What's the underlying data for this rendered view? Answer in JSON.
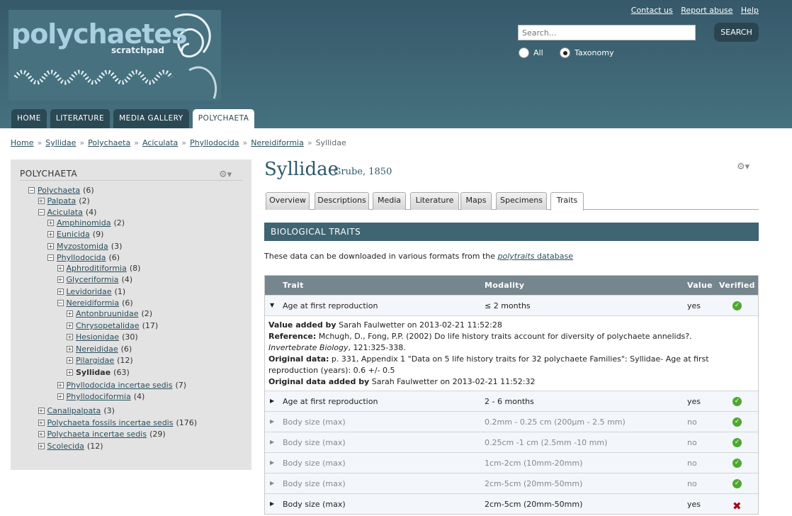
{
  "header": {
    "logo_text": "polychaetes",
    "logo_subtext": "scratchpad",
    "top_links": [
      "Contact us",
      "Report abuse",
      "Help"
    ],
    "search_placeholder": "Search...",
    "search_button": "SEARCH",
    "radio_all": "All",
    "radio_taxonomy": "Taxonomy",
    "nav_tabs": [
      "HOME",
      "LITERATURE",
      "MEDIA GALLERY",
      "POLYCHAETA"
    ]
  },
  "breadcrumb": [
    "Home",
    "Syllidae",
    "Polychaeta",
    "Aciculata",
    "Phyllodocida",
    "Nereidiformia",
    "Syllidae"
  ],
  "sidebar": {
    "title": "POLYCHAETA",
    "tree": [
      {
        "label": "Polychaeta",
        "count": "(6)",
        "box": "−"
      },
      {
        "label": "Palpata",
        "count": "(2)",
        "box": "+"
      },
      {
        "label": "Aciculata",
        "count": "(4)",
        "box": "−"
      },
      {
        "label": "Amphinomida",
        "count": "(2)",
        "box": "+"
      },
      {
        "label": "Eunicida",
        "count": "(9)",
        "box": "+"
      },
      {
        "label": "Myzostomida",
        "count": "(3)",
        "box": "+"
      },
      {
        "label": "Phyllodocida",
        "count": "(6)",
        "box": "−"
      },
      {
        "label": "Aphroditiformia",
        "count": "(8)",
        "box": "+"
      },
      {
        "label": "Glyceriformia",
        "count": "(4)",
        "box": "+"
      },
      {
        "label": "Levidoridae",
        "count": "(1)",
        "box": "+"
      },
      {
        "label": "Nereidiformia",
        "count": "(6)",
        "box": "−"
      },
      {
        "label": "Antonbruunidae",
        "count": "(2)",
        "box": "+"
      },
      {
        "label": "Chrysopetalidae",
        "count": "(17)",
        "box": "+"
      },
      {
        "label": "Hesionidae",
        "count": "(30)",
        "box": "+"
      },
      {
        "label": "Nereididae",
        "count": "(6)",
        "box": "+"
      },
      {
        "label": "Pilargidae",
        "count": "(12)",
        "box": "+"
      },
      {
        "label": "Syllidae",
        "count": "(63)",
        "box": "+"
      },
      {
        "label": "Phyllodocida incertae sedis",
        "count": "(7)",
        "box": "+"
      },
      {
        "label": "Phyllodociformia",
        "count": "(4)",
        "box": "+"
      },
      {
        "label": "Canalipalpata",
        "count": "(3)",
        "box": "+"
      },
      {
        "label": "Polychaeta fossils incertae sedis",
        "count": "(176)",
        "box": "+"
      },
      {
        "label": "Polychaeta incertae sedis",
        "count": "(29)",
        "box": "+"
      },
      {
        "label": "Scolecida",
        "count": "(12)",
        "box": "+"
      }
    ]
  },
  "main": {
    "title": "Syllidae",
    "author": "Grube, 1850",
    "tabs": [
      "Overview",
      "Descriptions",
      "Media",
      "Literature",
      "Maps",
      "Specimens",
      "Traits"
    ],
    "section_title": "BIOLOGICAL TRAITS",
    "download_prefix": "These data can be downloaded in various formats from the ",
    "download_link_italic": "polytraits",
    "download_link_rest": " database",
    "table_headers": {
      "trait": "Trait",
      "modality": "Modality",
      "value": "Value",
      "verified": "Verified"
    },
    "detail": {
      "value_added_by_label": "Value added by",
      "value_added_by": " Sarah Faulwetter on 2013-02-21 11:52:28",
      "reference_label": "Reference:",
      "reference": " Mchugh, D., Fong, P.P. (2002) Do life history traits account for diversity of polychaete annelids?.",
      "journal": "Invertebrate Biology",
      "journal_rest": ", 121:325-338.",
      "original_data_label": "Original data:",
      "original_data": " p. 331, Appendix 1 \"Data on 5 life history traits for 32 polychaete Families\": Syllidae- Age at first reproduction (years): 0.6 +/- 0.5",
      "original_added_label": "Original data added by",
      "original_added": " Sarah Faulwetter on 2013-02-21 11:52:32"
    },
    "rows": [
      {
        "arrow": "▼",
        "trait": "Age at first reproduction",
        "modality": "≤ 2 months",
        "value": "yes",
        "verified": true,
        "dim": false
      },
      {
        "arrow": "▶",
        "trait": "Age at first reproduction",
        "modality": "2 - 6 months",
        "value": "yes",
        "verified": true,
        "dim": false
      },
      {
        "arrow": "▶",
        "trait": "Body size (max)",
        "modality": "0.2mm - 0.25 cm (200μm - 2.5 mm)",
        "value": "no",
        "verified": true,
        "dim": true
      },
      {
        "arrow": "▶",
        "trait": "Body size (max)",
        "modality": "0.25cm -1 cm (2.5mm -10 mm)",
        "value": "no",
        "verified": true,
        "dim": true
      },
      {
        "arrow": "▶",
        "trait": "Body size (max)",
        "modality": "1cm-2cm (10mm-20mm)",
        "value": "no",
        "verified": true,
        "dim": true
      },
      {
        "arrow": "▶",
        "trait": "Body size (max)",
        "modality": "2cm-5cm (20mm-50mm)",
        "value": "no",
        "verified": true,
        "dim": true
      },
      {
        "arrow": "▶",
        "trait": "Body size (max)",
        "modality": "2cm-5cm (20mm-50mm)",
        "value": "yes",
        "verified": false,
        "dim": false
      }
    ]
  },
  "colors": {
    "header": "#3f6472",
    "nav_tab": "#2b4855",
    "verified": "#4fa830",
    "rejected": "#b0001a"
  },
  "icons": [
    "gear-icon",
    "check-icon",
    "cross-icon",
    "expand-icon",
    "collapse-icon"
  ]
}
